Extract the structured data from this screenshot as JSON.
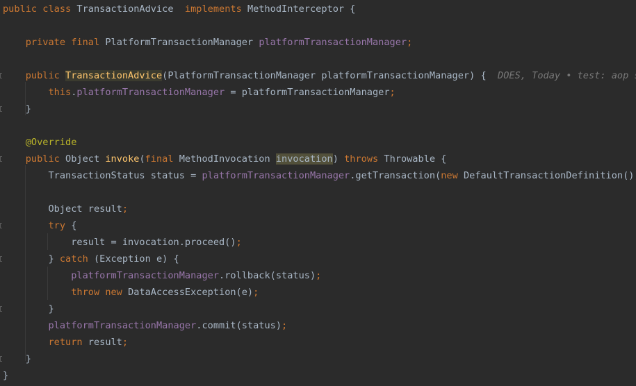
{
  "editor": {
    "lines": [
      {
        "tokens": [
          {
            "t": "public class ",
            "c": "kw"
          },
          {
            "t": "TransactionAdvice  ",
            "c": "cls"
          },
          {
            "t": "implements ",
            "c": "kw"
          },
          {
            "t": "MethodInterceptor {",
            "c": "cls"
          }
        ]
      },
      {
        "tokens": []
      },
      {
        "tokens": [
          {
            "t": "    private final ",
            "c": "kw"
          },
          {
            "t": "PlatformTransactionManager ",
            "c": "cls"
          },
          {
            "t": "platformTransactionManager",
            "c": "fld"
          },
          {
            "t": ";",
            "c": "kw"
          }
        ]
      },
      {
        "tokens": []
      },
      {
        "tokens": [
          {
            "t": "    public ",
            "c": "kw"
          },
          {
            "t": "TransactionAdvice",
            "c": "mth hl2"
          },
          {
            "t": "(PlatformTransactionManager platformTransactionManager) {  ",
            "c": "cls"
          },
          {
            "t": "DOES, Today • test: aop st",
            "c": "blame"
          }
        ],
        "fold": true
      },
      {
        "tokens": [
          {
            "t": "        this",
            "c": "kw"
          },
          {
            "t": ".",
            "c": "cls"
          },
          {
            "t": "platformTransactionManager",
            "c": "fld"
          },
          {
            "t": " = platformTransactionManager",
            "c": "cls"
          },
          {
            "t": ";",
            "c": "kw"
          }
        ]
      },
      {
        "tokens": [
          {
            "t": "    }",
            "c": "cls"
          }
        ],
        "fold": true
      },
      {
        "tokens": []
      },
      {
        "tokens": [
          {
            "t": "    @Override",
            "c": "ann"
          }
        ]
      },
      {
        "tokens": [
          {
            "t": "    public ",
            "c": "kw"
          },
          {
            "t": "Object ",
            "c": "cls"
          },
          {
            "t": "invoke",
            "c": "mth"
          },
          {
            "t": "(",
            "c": "cls"
          },
          {
            "t": "final ",
            "c": "kw"
          },
          {
            "t": "MethodInvocation ",
            "c": "cls"
          },
          {
            "t": "invocation",
            "c": "sel"
          },
          {
            "t": ") ",
            "c": "cls"
          },
          {
            "t": "throws ",
            "c": "kw"
          },
          {
            "t": "Throwable {",
            "c": "cls"
          }
        ],
        "fold": true
      },
      {
        "tokens": [
          {
            "t": "        TransactionStatus status = ",
            "c": "cls"
          },
          {
            "t": "platformTransactionManager",
            "c": "fld"
          },
          {
            "t": ".getTransaction(",
            "c": "cls"
          },
          {
            "t": "new ",
            "c": "kw"
          },
          {
            "t": "DefaultTransactionDefinition())",
            "c": "cls"
          },
          {
            "t": ";",
            "c": "kw"
          }
        ]
      },
      {
        "tokens": []
      },
      {
        "tokens": [
          {
            "t": "        Object result",
            "c": "cls"
          },
          {
            "t": ";",
            "c": "kw"
          }
        ]
      },
      {
        "tokens": [
          {
            "t": "        try ",
            "c": "kw"
          },
          {
            "t": "{",
            "c": "cls"
          }
        ],
        "fold": true
      },
      {
        "tokens": [
          {
            "t": "            result = invocation.proceed()",
            "c": "cls"
          },
          {
            "t": ";",
            "c": "kw"
          }
        ]
      },
      {
        "tokens": [
          {
            "t": "        } ",
            "c": "cls"
          },
          {
            "t": "catch ",
            "c": "kw"
          },
          {
            "t": "(Exception e) {",
            "c": "cls"
          }
        ],
        "fold": true
      },
      {
        "tokens": [
          {
            "t": "            ",
            "c": "cls"
          },
          {
            "t": "platformTransactionManager",
            "c": "fld"
          },
          {
            "t": ".rollback(status)",
            "c": "cls"
          },
          {
            "t": ";",
            "c": "kw"
          }
        ]
      },
      {
        "tokens": [
          {
            "t": "            throw new ",
            "c": "kw"
          },
          {
            "t": "DataAccessException(e)",
            "c": "cls"
          },
          {
            "t": ";",
            "c": "kw"
          }
        ]
      },
      {
        "tokens": [
          {
            "t": "        }",
            "c": "cls"
          }
        ],
        "fold": true
      },
      {
        "tokens": [
          {
            "t": "        ",
            "c": "cls"
          },
          {
            "t": "platformTransactionManager",
            "c": "fld"
          },
          {
            "t": ".commit(status)",
            "c": "cls"
          },
          {
            "t": ";",
            "c": "kw"
          }
        ]
      },
      {
        "tokens": [
          {
            "t": "        return ",
            "c": "kw"
          },
          {
            "t": "result",
            "c": "cls"
          },
          {
            "t": ";",
            "c": "kw"
          }
        ]
      },
      {
        "tokens": [
          {
            "t": "    }",
            "c": "cls"
          }
        ],
        "fold": true
      },
      {
        "tokens": [
          {
            "t": "}",
            "c": "cls"
          }
        ]
      }
    ]
  },
  "colors": {
    "background": "#2b2b2b",
    "keyword": "#cc7832",
    "field": "#9876aa",
    "method": "#ffc66d",
    "annotation": "#bbb529",
    "text": "#a9b7c6",
    "blame": "#787878"
  }
}
